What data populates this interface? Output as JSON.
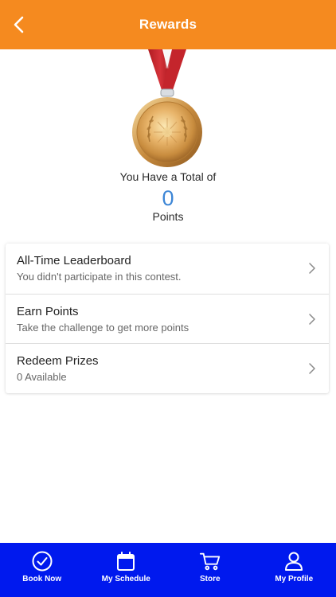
{
  "header": {
    "title": "Rewards",
    "back_icon": "chevron-left-icon",
    "background": "#f58a1f"
  },
  "summary": {
    "total_text": "You Have a Total of",
    "points_value": "0",
    "points_label": "Points",
    "points_color": "#3d86d6",
    "medal_icon": "gold-medal-icon"
  },
  "rewards_list": [
    {
      "title": "All-Time Leaderboard",
      "subtitle": "You didn't participate in this contest."
    },
    {
      "title": "Earn Points",
      "subtitle": "Take the challenge to get more points"
    },
    {
      "title": "Redeem Prizes",
      "subtitle": "0 Available"
    }
  ],
  "tabbar": {
    "background": "#0019ee",
    "tabs": [
      {
        "label": "Book Now",
        "icon": "check-circle-icon"
      },
      {
        "label": "My Schedule",
        "icon": "calendar-icon"
      },
      {
        "label": "Store",
        "icon": "cart-icon"
      },
      {
        "label": "My Profile",
        "icon": "user-icon"
      }
    ]
  }
}
